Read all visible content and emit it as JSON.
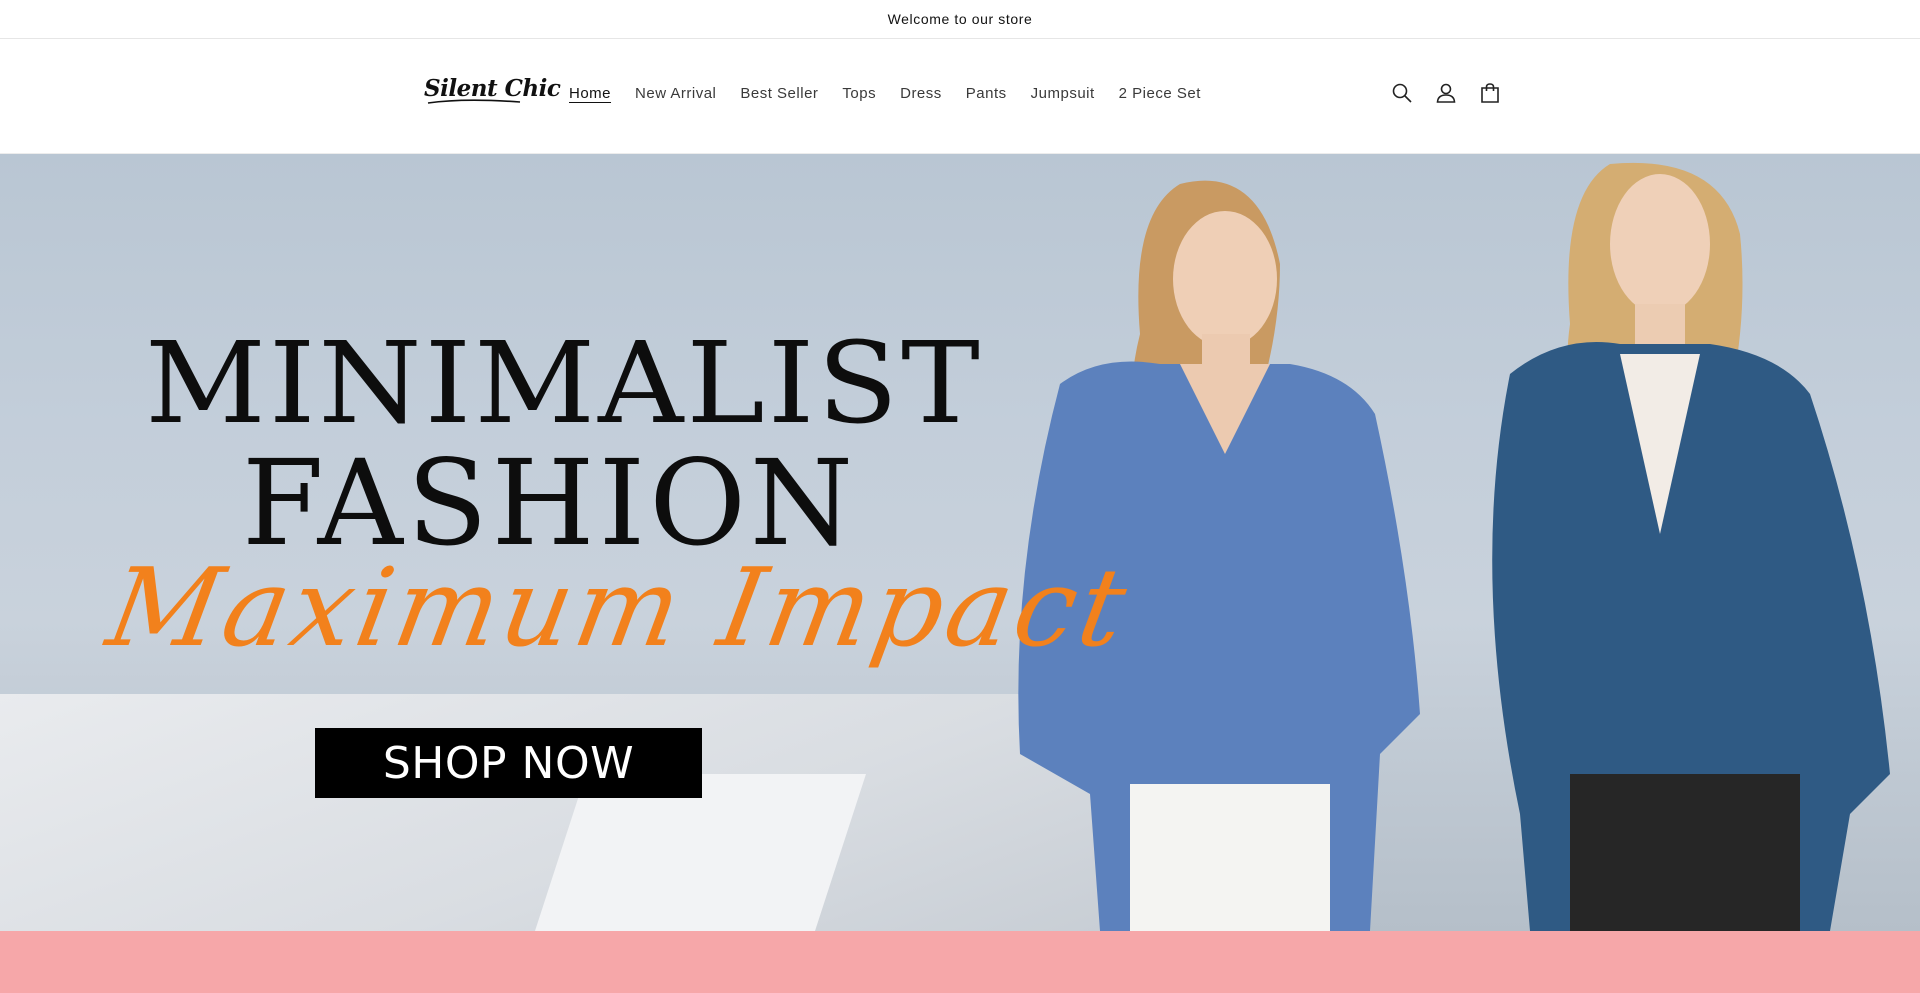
{
  "announcement": {
    "text": "Welcome to our store"
  },
  "header": {
    "logo_text": "Silent Chic",
    "nav": [
      {
        "label": "Home",
        "active": true
      },
      {
        "label": "New Arrival"
      },
      {
        "label": "Best Seller"
      },
      {
        "label": "Tops"
      },
      {
        "label": "Dress"
      },
      {
        "label": "Pants"
      },
      {
        "label": "Jumpsuit"
      },
      {
        "label": "2 Piece Set"
      }
    ],
    "icons": [
      "search-icon",
      "account-icon",
      "cart-icon"
    ]
  },
  "hero": {
    "headline_line1": "MINIMALIST",
    "headline_line2": "FASHION",
    "script_text": "Maximum Impact",
    "cta_label": "SHOP NOW",
    "accent_color": "#f2811c",
    "background_color": "#c3ceda"
  },
  "next_section": {
    "background_color": "#f6a7a9"
  }
}
